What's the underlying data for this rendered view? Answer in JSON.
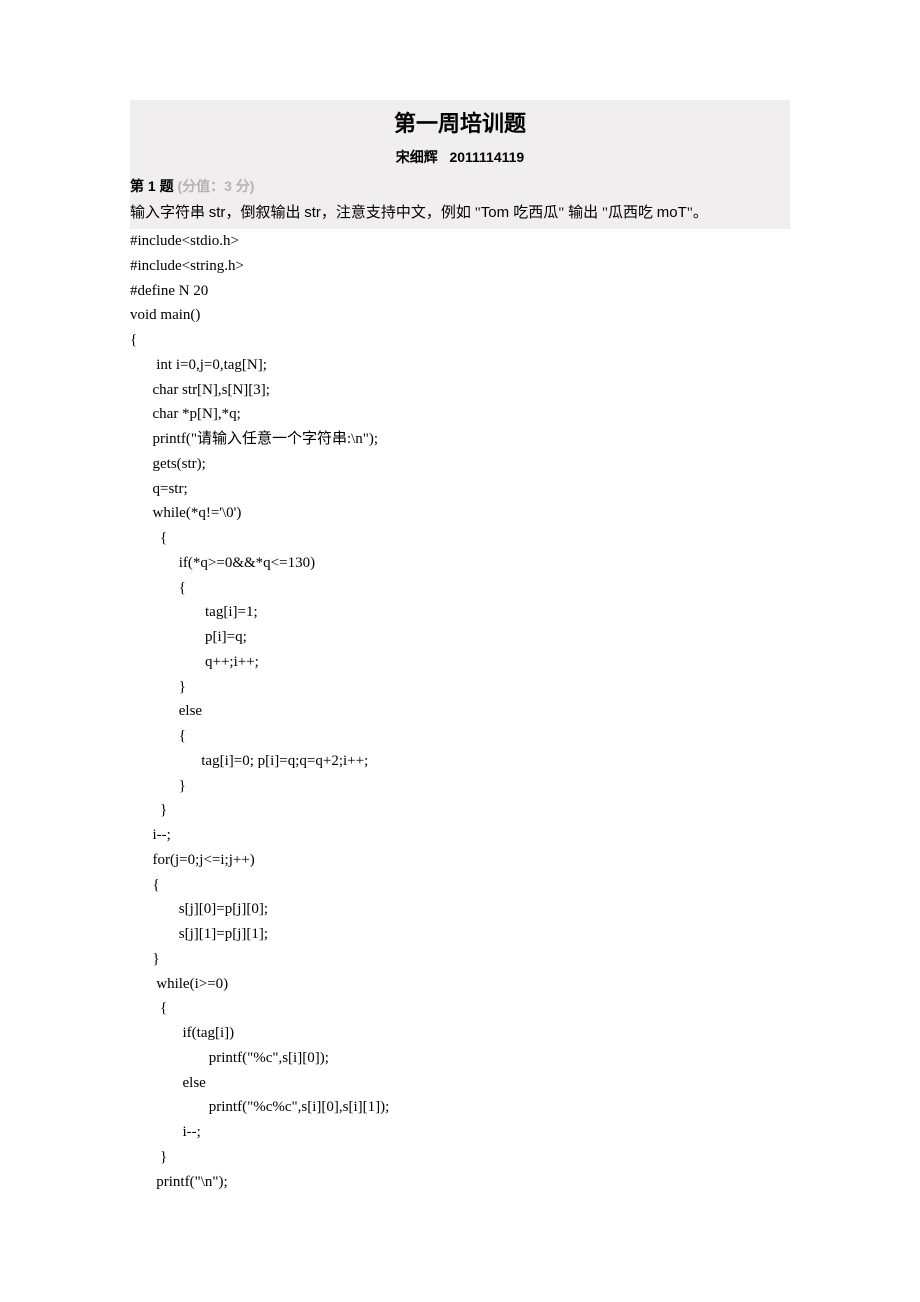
{
  "title": "第一周培训题",
  "author_name": "宋细辉",
  "author_id": "2011114119",
  "question": {
    "label": "第 1 题",
    "score": "(分值：3 分)",
    "desc_1": "输入字符串 ",
    "desc_2": "str",
    "desc_3": "，倒叙输出 ",
    "desc_4": "str",
    "desc_5": "，注意支持中文，例如 \"",
    "desc_6": "Tom ",
    "desc_7": "吃西瓜\" 输出 \"瓜西吃 ",
    "desc_8": "moT",
    "desc_9": "\"。"
  },
  "code": [
    "#include<stdio.h>",
    "#include<string.h>",
    "#define N 20",
    "void main()",
    "{",
    "       int i=0,j=0,tag[N];",
    "      char str[N],s[N][3];",
    "      char *p[N],*q;",
    "      printf(\"请输入任意一个字符串:\\n\");",
    "      gets(str);",
    "      q=str;",
    "      while(*q!='\\0')",
    "        {",
    "             if(*q>=0&&*q<=130)",
    "             {",
    "                    tag[i]=1;",
    "                    p[i]=q;",
    "                    q++;i++;",
    "             }",
    "             else",
    "             {",
    "                   tag[i]=0; p[i]=q;q=q+2;i++;",
    "             }",
    "        }",
    "      i--;",
    "      for(j=0;j<=i;j++)",
    "      {",
    "             s[j][0]=p[j][0];",
    "             s[j][1]=p[j][1];",
    "      }",
    "       while(i>=0)",
    "        {",
    "              if(tag[i])",
    "                     printf(\"%c\",s[i][0]);",
    "              else",
    "                     printf(\"%c%c\",s[i][0],s[i][1]);",
    "              i--;",
    "        }",
    "       printf(\"\\n\");"
  ]
}
